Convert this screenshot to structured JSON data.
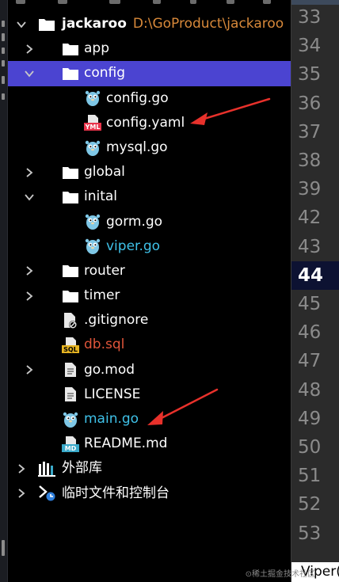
{
  "project": {
    "name": "jackaroo",
    "path": "D:\\GoProduct\\jackaroo"
  },
  "tree": [
    {
      "label": "app",
      "icon": "folder-icon",
      "chevron": "right",
      "level": 1
    },
    {
      "label": "config",
      "icon": "folder-icon",
      "chevron": "down",
      "level": 1,
      "selected": true
    },
    {
      "label": "config.go",
      "icon": "gopher-icon",
      "level": 2
    },
    {
      "label": "config.yaml",
      "icon": "yaml-file-icon",
      "level": 2
    },
    {
      "label": "mysql.go",
      "icon": "gopher-icon",
      "level": 2
    },
    {
      "label": "global",
      "icon": "folder-icon",
      "chevron": "right",
      "level": 1
    },
    {
      "label": "inital",
      "icon": "folder-icon",
      "chevron": "down",
      "level": 1
    },
    {
      "label": "gorm.go",
      "icon": "gopher-icon",
      "level": 2
    },
    {
      "label": "viper.go",
      "icon": "gopher-icon",
      "level": 2,
      "color": "#3fc1e8"
    },
    {
      "label": "router",
      "icon": "folder-icon",
      "chevron": "right",
      "level": 1
    },
    {
      "label": "timer",
      "icon": "folder-icon",
      "chevron": "right",
      "level": 1
    },
    {
      "label": ".gitignore",
      "icon": "gitignore-file-icon",
      "level": 1
    },
    {
      "label": "db.sql",
      "icon": "sql-file-icon",
      "level": 1,
      "color": "#e0553a"
    },
    {
      "label": "go.mod",
      "icon": "text-file-icon",
      "chevron": "right",
      "level": 1
    },
    {
      "label": "LICENSE",
      "icon": "text-file-icon",
      "level": 1
    },
    {
      "label": "main.go",
      "icon": "gopher-icon",
      "level": 1,
      "color": "#3fc1e8"
    },
    {
      "label": "README.md",
      "icon": "markdown-file-icon",
      "level": 1
    }
  ],
  "root_sections": [
    {
      "label": "外部库",
      "icon": "library-icon"
    },
    {
      "label": "临时文件和控制台",
      "icon": "scratch-console-icon"
    }
  ],
  "editor": {
    "line_numbers": [
      "33",
      "34",
      "35",
      "36",
      "37",
      "38",
      "39",
      "42",
      "43",
      "44",
      "45",
      "46",
      "47",
      "48",
      "49",
      "50",
      "51",
      "52",
      "53"
    ],
    "current_line": "44",
    "status_text": "Viper("
  },
  "colors": {
    "selection": "#4b44d1",
    "path_text": "#d8893a",
    "highlight_blue": "#3fc1e8",
    "sql_red": "#e0553a",
    "annotation_arrow": "#e8312b"
  }
}
